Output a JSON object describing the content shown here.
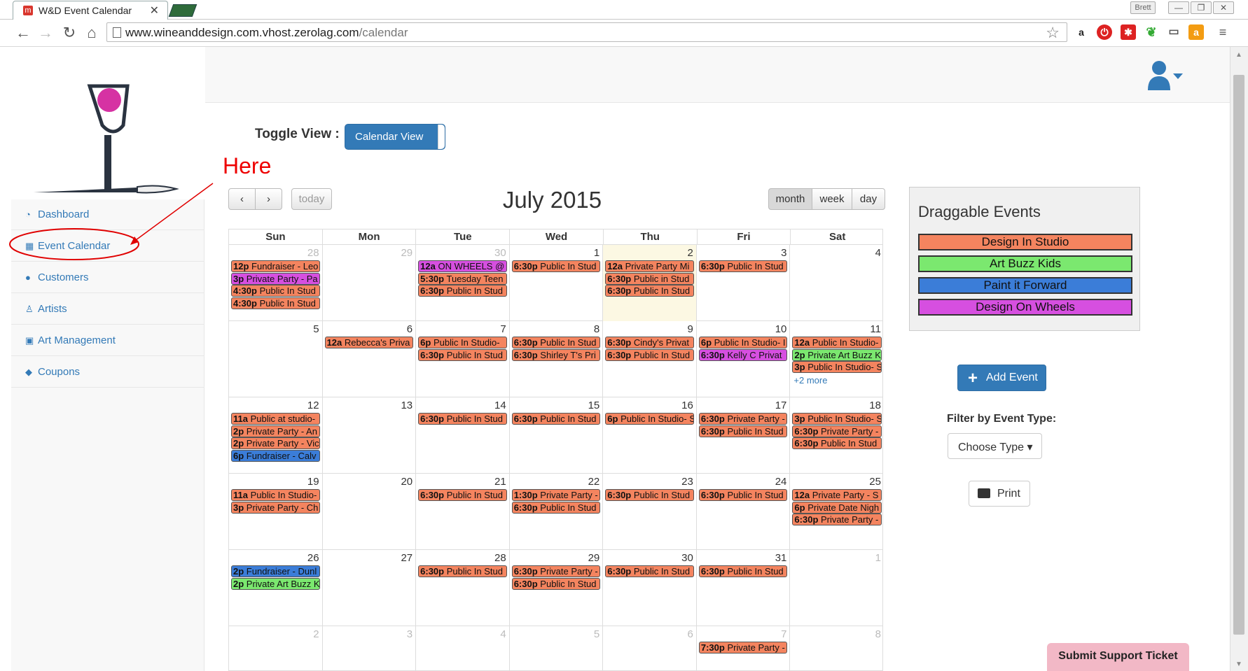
{
  "browser": {
    "tab_title": "W&D Event Calendar",
    "tab_close": "✕",
    "profile_name": "Brett",
    "window_minimize": "—",
    "window_restore": "❐",
    "window_close": "✕",
    "url_host": "www.wineanddesign.com.vhost.zerolag.com",
    "url_path": "/calendar"
  },
  "sidebar": {
    "items": [
      {
        "label": "Dashboard",
        "icon": "dashboard-icon"
      },
      {
        "label": "Event Calendar",
        "icon": "calendar-icon"
      },
      {
        "label": "Customers",
        "icon": "users-icon"
      },
      {
        "label": "Artists",
        "icon": "artist-icon"
      },
      {
        "label": "Art Management",
        "icon": "picture-icon"
      },
      {
        "label": "Coupons",
        "icon": "tag-icon"
      }
    ]
  },
  "annotation": {
    "text": "Here",
    "color": "#e00000"
  },
  "toggle": {
    "label": "Toggle View :",
    "value": "Calendar View"
  },
  "calendar": {
    "title": "July 2015",
    "prev": "‹",
    "next": "›",
    "today_btn": "today",
    "views": [
      "month",
      "week",
      "day"
    ],
    "active_view": "month",
    "day_headers": [
      "Sun",
      "Mon",
      "Tue",
      "Wed",
      "Thu",
      "Fri",
      "Sat"
    ],
    "weeks": [
      {
        "days": [
          {
            "n": "28",
            "other": true,
            "events": [
              {
                "t": "12p",
                "x": "Fundraiser - Leo",
                "c": "orange"
              },
              {
                "t": "3p",
                "x": "Private Party - Pa",
                "c": "purple"
              },
              {
                "t": "4:30p",
                "x": "Public In Stud",
                "c": "orange"
              },
              {
                "t": "4:30p",
                "x": "Public In Stud",
                "c": "orange"
              }
            ]
          },
          {
            "n": "29",
            "other": true,
            "events": []
          },
          {
            "n": "30",
            "other": true,
            "events": [
              {
                "t": "12a",
                "x": "ON WHEELS @",
                "c": "purple"
              },
              {
                "t": "5:30p",
                "x": "Tuesday Teen",
                "c": "orange"
              },
              {
                "t": "6:30p",
                "x": "Public In Stud",
                "c": "orange"
              }
            ]
          },
          {
            "n": "1",
            "events": [
              {
                "t": "6:30p",
                "x": "Public In Stud",
                "c": "orange"
              }
            ]
          },
          {
            "n": "2",
            "today": true,
            "events": [
              {
                "t": "12a",
                "x": "Private Party Mi",
                "c": "orange"
              },
              {
                "t": "6:30p",
                "x": "Public in Stud",
                "c": "orange"
              },
              {
                "t": "6:30p",
                "x": "Public In Stud",
                "c": "orange"
              }
            ]
          },
          {
            "n": "3",
            "events": [
              {
                "t": "6:30p",
                "x": "Public In Stud",
                "c": "orange"
              }
            ]
          },
          {
            "n": "4",
            "events": []
          }
        ]
      },
      {
        "days": [
          {
            "n": "5",
            "events": []
          },
          {
            "n": "6",
            "events": [
              {
                "t": "12a",
                "x": "Rebecca's Priva",
                "c": "orange"
              }
            ]
          },
          {
            "n": "7",
            "events": [
              {
                "t": "6p",
                "x": "Public In Studio-",
                "c": "orange"
              },
              {
                "t": "6:30p",
                "x": "Public In Stud",
                "c": "orange"
              }
            ]
          },
          {
            "n": "8",
            "events": [
              {
                "t": "6:30p",
                "x": "Public In Stud",
                "c": "orange"
              },
              {
                "t": "6:30p",
                "x": "Shirley T's Pri",
                "c": "orange"
              }
            ]
          },
          {
            "n": "9",
            "events": [
              {
                "t": "6:30p",
                "x": "Cindy's Privat",
                "c": "orange"
              },
              {
                "t": "6:30p",
                "x": "Public In Stud",
                "c": "orange"
              }
            ]
          },
          {
            "n": "10",
            "events": [
              {
                "t": "6p",
                "x": "Public In Studio- I",
                "c": "orange"
              },
              {
                "t": "6:30p",
                "x": "Kelly C Privat",
                "c": "purple"
              }
            ]
          },
          {
            "n": "11",
            "more": "+2 more",
            "events": [
              {
                "t": "12a",
                "x": "Public In Studio-",
                "c": "orange"
              },
              {
                "t": "2p",
                "x": "Private Art Buzz K",
                "c": "green"
              },
              {
                "t": "3p",
                "x": "Public In Studio- S",
                "c": "orange"
              }
            ]
          }
        ]
      },
      {
        "days": [
          {
            "n": "12",
            "events": [
              {
                "t": "11a",
                "x": "Public at studio-",
                "c": "orange"
              },
              {
                "t": "2p",
                "x": "Private Party - An",
                "c": "orange"
              },
              {
                "t": "2p",
                "x": "Private Party - Vic",
                "c": "orange"
              },
              {
                "t": "6p",
                "x": "Fundraiser - Calv",
                "c": "blue"
              }
            ]
          },
          {
            "n": "13",
            "events": []
          },
          {
            "n": "14",
            "events": [
              {
                "t": "6:30p",
                "x": "Public In Stud",
                "c": "orange"
              }
            ]
          },
          {
            "n": "15",
            "events": [
              {
                "t": "6:30p",
                "x": "Public In Stud",
                "c": "orange"
              }
            ]
          },
          {
            "n": "16",
            "events": [
              {
                "t": "6p",
                "x": "Public In Studio- S",
                "c": "orange"
              }
            ]
          },
          {
            "n": "17",
            "events": [
              {
                "t": "6:30p",
                "x": "Private Party -",
                "c": "orange"
              },
              {
                "t": "6:30p",
                "x": "Public In Stud",
                "c": "orange"
              }
            ]
          },
          {
            "n": "18",
            "events": [
              {
                "t": "3p",
                "x": "Public In Studio- S",
                "c": "orange"
              },
              {
                "t": "6:30p",
                "x": "Private Party -",
                "c": "orange"
              },
              {
                "t": "6:30p",
                "x": "Public In Stud",
                "c": "orange"
              }
            ]
          }
        ]
      },
      {
        "days": [
          {
            "n": "19",
            "events": [
              {
                "t": "11a",
                "x": "Public In Studio-",
                "c": "orange"
              },
              {
                "t": "3p",
                "x": "Private Party - Ch",
                "c": "orange"
              }
            ]
          },
          {
            "n": "20",
            "events": []
          },
          {
            "n": "21",
            "events": [
              {
                "t": "6:30p",
                "x": "Public In Stud",
                "c": "orange"
              }
            ]
          },
          {
            "n": "22",
            "events": [
              {
                "t": "1:30p",
                "x": "Private Party -",
                "c": "orange"
              },
              {
                "t": "6:30p",
                "x": "Public In Stud",
                "c": "orange"
              }
            ]
          },
          {
            "n": "23",
            "events": [
              {
                "t": "6:30p",
                "x": "Public In Stud",
                "c": "orange"
              }
            ]
          },
          {
            "n": "24",
            "events": [
              {
                "t": "6:30p",
                "x": "Public In Stud",
                "c": "orange"
              }
            ]
          },
          {
            "n": "25",
            "events": [
              {
                "t": "12a",
                "x": "Private Party - S",
                "c": "orange"
              },
              {
                "t": "6p",
                "x": "Private Date Nigh",
                "c": "orange"
              },
              {
                "t": "6:30p",
                "x": "Private Party -",
                "c": "orange"
              }
            ]
          }
        ]
      },
      {
        "days": [
          {
            "n": "26",
            "events": [
              {
                "t": "2p",
                "x": "Fundraiser - Dunl",
                "c": "blue"
              },
              {
                "t": "2p",
                "x": "Private Art Buzz K",
                "c": "green"
              }
            ]
          },
          {
            "n": "27",
            "events": []
          },
          {
            "n": "28",
            "events": [
              {
                "t": "6:30p",
                "x": "Public In Stud",
                "c": "orange"
              }
            ]
          },
          {
            "n": "29",
            "events": [
              {
                "t": "6:30p",
                "x": "Private Party -",
                "c": "orange"
              },
              {
                "t": "6:30p",
                "x": "Public In Stud",
                "c": "orange"
              }
            ]
          },
          {
            "n": "30",
            "events": [
              {
                "t": "6:30p",
                "x": "Public In Stud",
                "c": "orange"
              }
            ]
          },
          {
            "n": "31",
            "events": [
              {
                "t": "6:30p",
                "x": "Public In Stud",
                "c": "orange"
              }
            ]
          },
          {
            "n": "1",
            "other": true,
            "events": []
          }
        ]
      },
      {
        "days": [
          {
            "n": "2",
            "other": true,
            "events": []
          },
          {
            "n": "3",
            "other": true,
            "events": []
          },
          {
            "n": "4",
            "other": true,
            "events": []
          },
          {
            "n": "5",
            "other": true,
            "events": []
          },
          {
            "n": "6",
            "other": true,
            "events": []
          },
          {
            "n": "7",
            "other": true,
            "events": [
              {
                "t": "7:30p",
                "x": "Private Party -",
                "c": "orange"
              }
            ]
          },
          {
            "n": "8",
            "other": true,
            "events": []
          }
        ]
      }
    ]
  },
  "event_colors": {
    "orange": "#f4845f",
    "purple": "#d64fe0",
    "green": "#7be86f",
    "blue": "#3b7dd8"
  },
  "draggable": {
    "title": "Draggable Events",
    "items": [
      {
        "label": "Design In Studio",
        "c": "orange"
      },
      {
        "label": "Art Buzz Kids",
        "c": "green"
      },
      {
        "label": "Paint it Forward",
        "c": "blue"
      },
      {
        "label": "Design On Wheels",
        "c": "purple"
      }
    ]
  },
  "actions": {
    "add_event": "Add Event",
    "filter_label": "Filter by Event Type:",
    "choose_type": "Choose Type ▾",
    "print": "Print",
    "support": "Submit Support Ticket"
  }
}
